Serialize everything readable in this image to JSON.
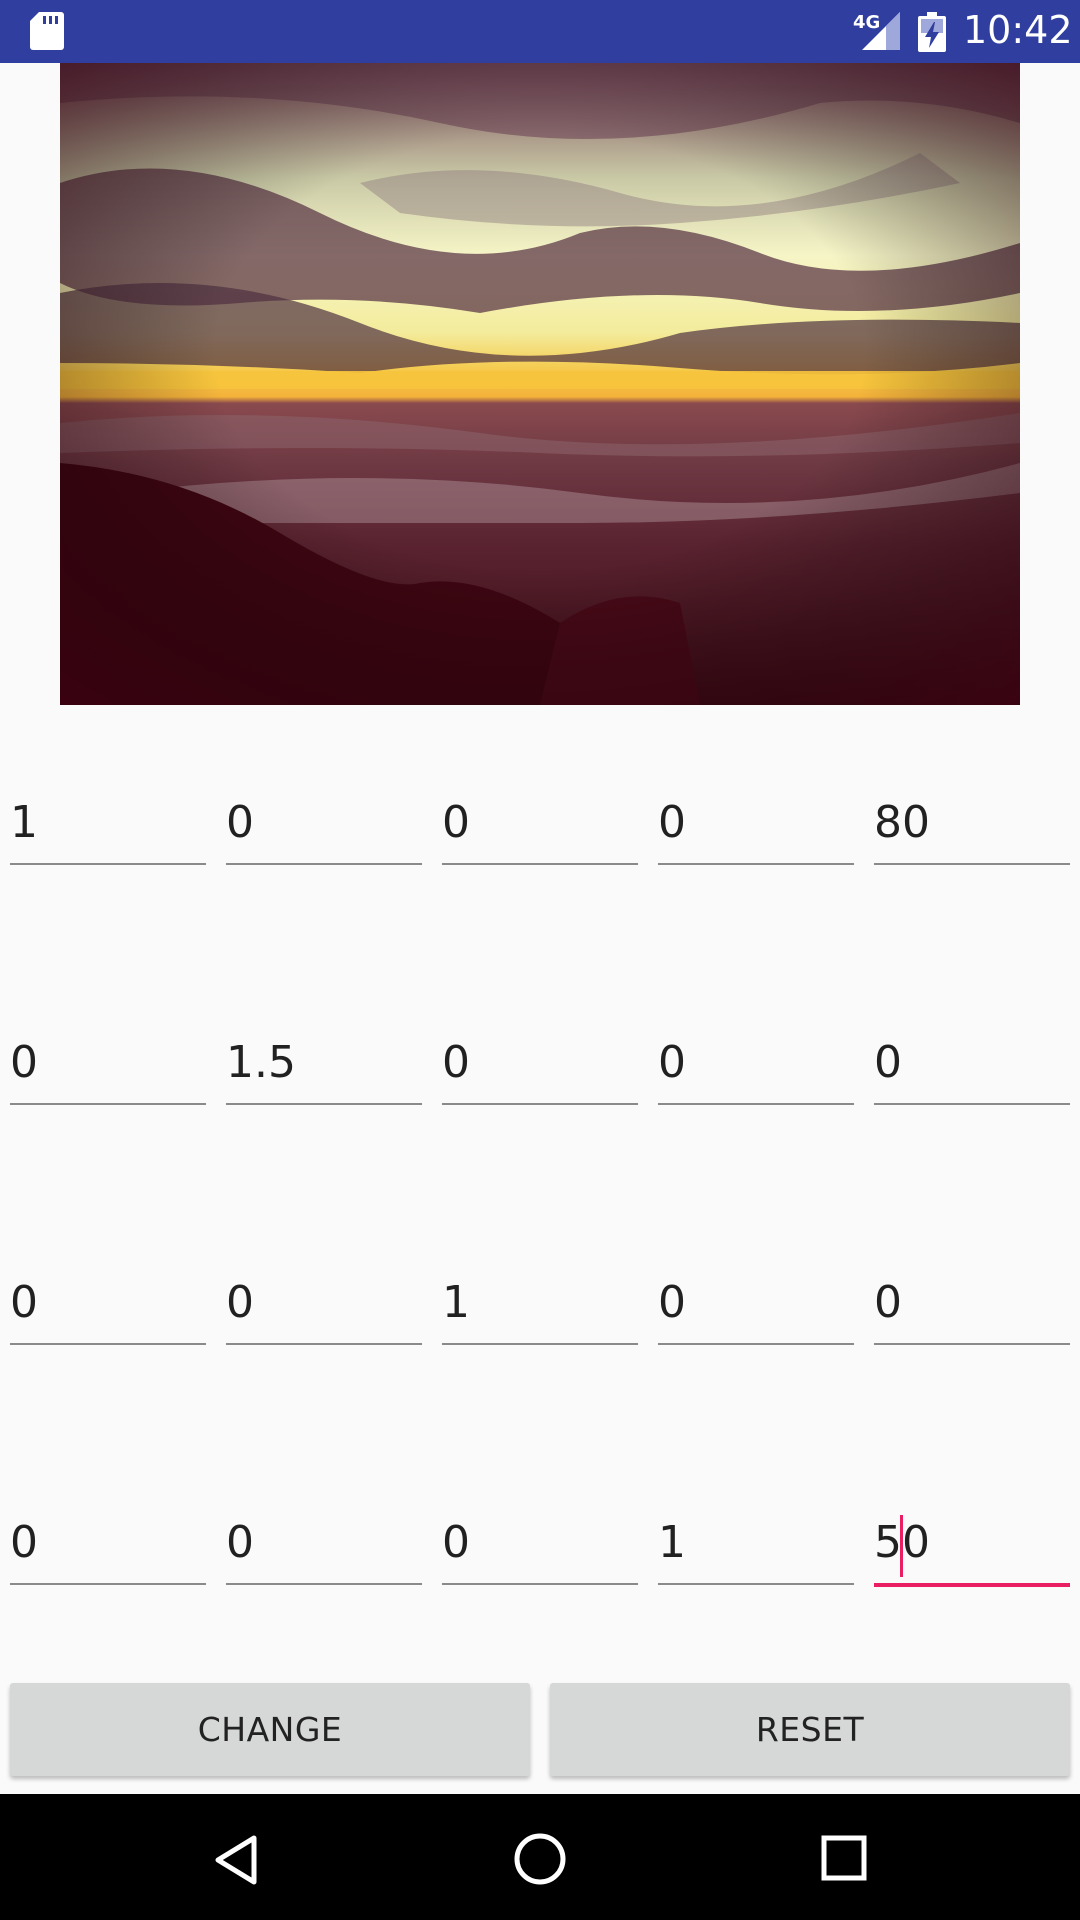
{
  "status_bar": {
    "network": "4G",
    "time": "10:42",
    "icons": [
      "sd-card-icon",
      "signal-icon",
      "battery-charging-icon"
    ]
  },
  "image": {
    "description_icon": "sunset-beach-photo"
  },
  "matrix": {
    "rows": [
      [
        "1",
        "0",
        "0",
        "0",
        "80"
      ],
      [
        "0",
        "1.5",
        "0",
        "0",
        "0"
      ],
      [
        "0",
        "0",
        "1",
        "0",
        "0"
      ],
      [
        "0",
        "0",
        "0",
        "1",
        "50"
      ]
    ],
    "active_cell": {
      "row": 3,
      "col": 4
    }
  },
  "buttons": {
    "change_label": "CHANGE",
    "reset_label": "RESET"
  },
  "nav_bar": {
    "icons": [
      "back-icon",
      "home-icon",
      "recents-icon"
    ]
  },
  "colors": {
    "status_bar": "#303f9f",
    "accent": "#e91e63",
    "button_bg": "#d6d7d7",
    "background": "#fafafa"
  }
}
